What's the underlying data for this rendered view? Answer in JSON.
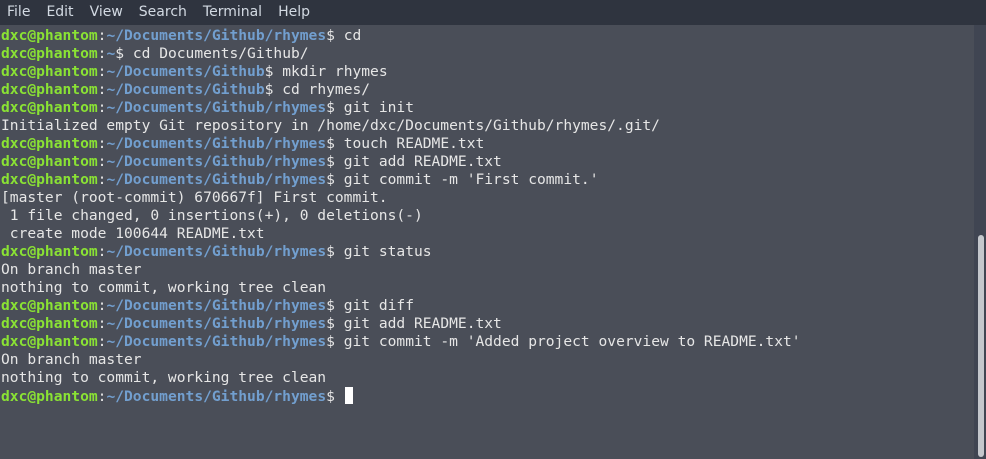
{
  "menu": {
    "items": [
      "File",
      "Edit",
      "View",
      "Search",
      "Terminal",
      "Help"
    ]
  },
  "prompt": {
    "user": "dxc@phantom",
    "colon": ":",
    "dollar": "$"
  },
  "lines": [
    {
      "type": "prompt",
      "path": "~/Documents/Github/rhymes",
      "cmd": " cd"
    },
    {
      "type": "prompt",
      "path": "~",
      "cmd": " cd Documents/Github/"
    },
    {
      "type": "prompt",
      "path": "~/Documents/Github",
      "cmd": " mkdir rhymes"
    },
    {
      "type": "prompt",
      "path": "~/Documents/Github",
      "cmd": " cd rhymes/"
    },
    {
      "type": "prompt",
      "path": "~/Documents/Github/rhymes",
      "cmd": " git init"
    },
    {
      "type": "output",
      "text": "Initialized empty Git repository in /home/dxc/Documents/Github/rhymes/.git/"
    },
    {
      "type": "prompt",
      "path": "~/Documents/Github/rhymes",
      "cmd": " touch README.txt"
    },
    {
      "type": "prompt",
      "path": "~/Documents/Github/rhymes",
      "cmd": " git add README.txt"
    },
    {
      "type": "prompt",
      "path": "~/Documents/Github/rhymes",
      "cmd": " git commit -m 'First commit.'"
    },
    {
      "type": "output",
      "text": "[master (root-commit) 670667f] First commit."
    },
    {
      "type": "output",
      "text": " 1 file changed, 0 insertions(+), 0 deletions(-)"
    },
    {
      "type": "output",
      "text": " create mode 100644 README.txt"
    },
    {
      "type": "prompt",
      "path": "~/Documents/Github/rhymes",
      "cmd": " git status"
    },
    {
      "type": "output",
      "text": "On branch master"
    },
    {
      "type": "output",
      "text": "nothing to commit, working tree clean"
    },
    {
      "type": "prompt",
      "path": "~/Documents/Github/rhymes",
      "cmd": " git diff"
    },
    {
      "type": "prompt",
      "path": "~/Documents/Github/rhymes",
      "cmd": " git add README.txt"
    },
    {
      "type": "prompt",
      "path": "~/Documents/Github/rhymes",
      "cmd": " git commit -m 'Added project overview to README.txt'"
    },
    {
      "type": "output",
      "text": "On branch master"
    },
    {
      "type": "output",
      "text": "nothing to commit, working tree clean"
    },
    {
      "type": "prompt",
      "path": "~/Documents/Github/rhymes",
      "cmd": " ",
      "cursor": true
    }
  ],
  "colors": {
    "background": "#4a4e58",
    "menubar": "#2f343f",
    "user": "#8ae234",
    "path": "#729fcf",
    "text": "#e6e6e6"
  }
}
